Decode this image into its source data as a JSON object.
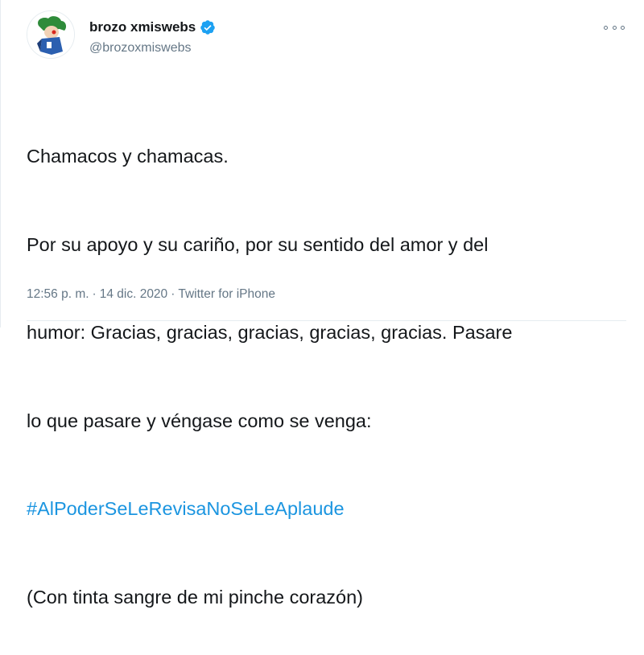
{
  "user": {
    "display_name": "brozo xmiswebs",
    "handle": "@brozoxmiswebs",
    "verified": true,
    "verified_color": "#1da1f2"
  },
  "tweet": {
    "lines": [
      "Chamacos y chamacas.",
      "Por su apoyo y su cariño, por su sentido del amor y del",
      "humor: Gracias, gracias, gracias, gracias, gracias. Pasare",
      "lo que pasare y véngase como se venga:"
    ],
    "hashtag": "#AlPoderSeLeRevisaNoSeLeAplaude",
    "closing_line": "(Con tinta sangre de mi pinche corazón)",
    "hashtag_color": "#1b95e0"
  },
  "meta": {
    "time": "12:56 p. m.",
    "separator": "·",
    "date": "14 dic. 2020",
    "source": "Twitter for iPhone"
  },
  "icons": {
    "more": "more-options-icon",
    "verified": "verified-badge-icon"
  }
}
